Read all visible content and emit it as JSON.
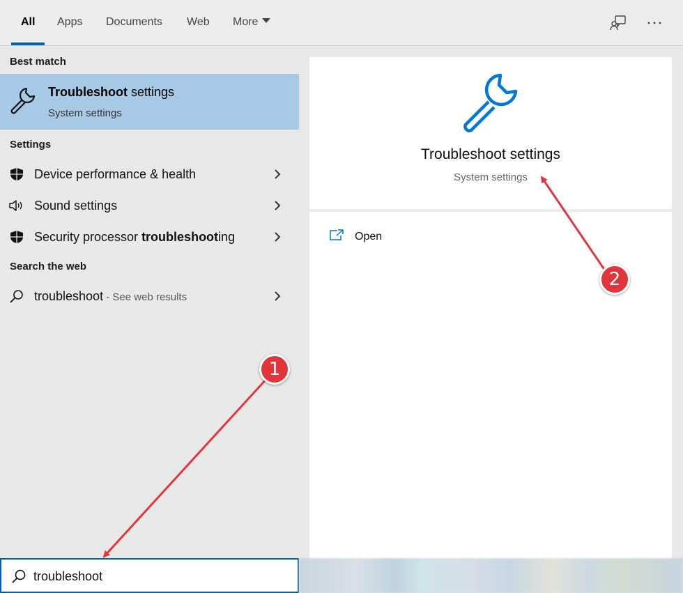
{
  "tabs": [
    {
      "label": "All",
      "active": true
    },
    {
      "label": "Apps"
    },
    {
      "label": "Documents"
    },
    {
      "label": "Web"
    },
    {
      "label": "More"
    }
  ],
  "top_icons": [
    "feedback-icon",
    "more-options-icon"
  ],
  "sections": {
    "best_match": "Best match",
    "settings": "Settings",
    "search_web": "Search the web"
  },
  "best_match": {
    "title_bold": "Troubleshoot",
    "title_rest": " settings",
    "subtitle": "System settings",
    "icon": "wrench-icon"
  },
  "settings_items": [
    {
      "label": "Device performance & health",
      "icon": "shield-icon"
    },
    {
      "label": "Sound settings",
      "icon": "speaker-icon"
    },
    {
      "label_pre": "Security processor ",
      "label_bold": "troubleshoot",
      "label_post": "ing",
      "icon": "shield-icon"
    }
  ],
  "web_item": {
    "label": "troubleshoot",
    "hint": " - See web results",
    "icon": "search-icon"
  },
  "preview": {
    "title": "Troubleshoot settings",
    "subtitle": "System settings",
    "icon": "wrench-icon",
    "accent": "#0078d7"
  },
  "actions": [
    {
      "label": "Open",
      "icon": "open-icon"
    }
  ],
  "search": {
    "value": "troubleshoot"
  },
  "annotations": [
    {
      "number": "1",
      "color": "#e2343b"
    },
    {
      "number": "2",
      "color": "#e2343b"
    }
  ],
  "colors": {
    "selection": "#a8c9e6",
    "focus_border": "#0063b1",
    "pane_bg": "#e8e8e8"
  }
}
